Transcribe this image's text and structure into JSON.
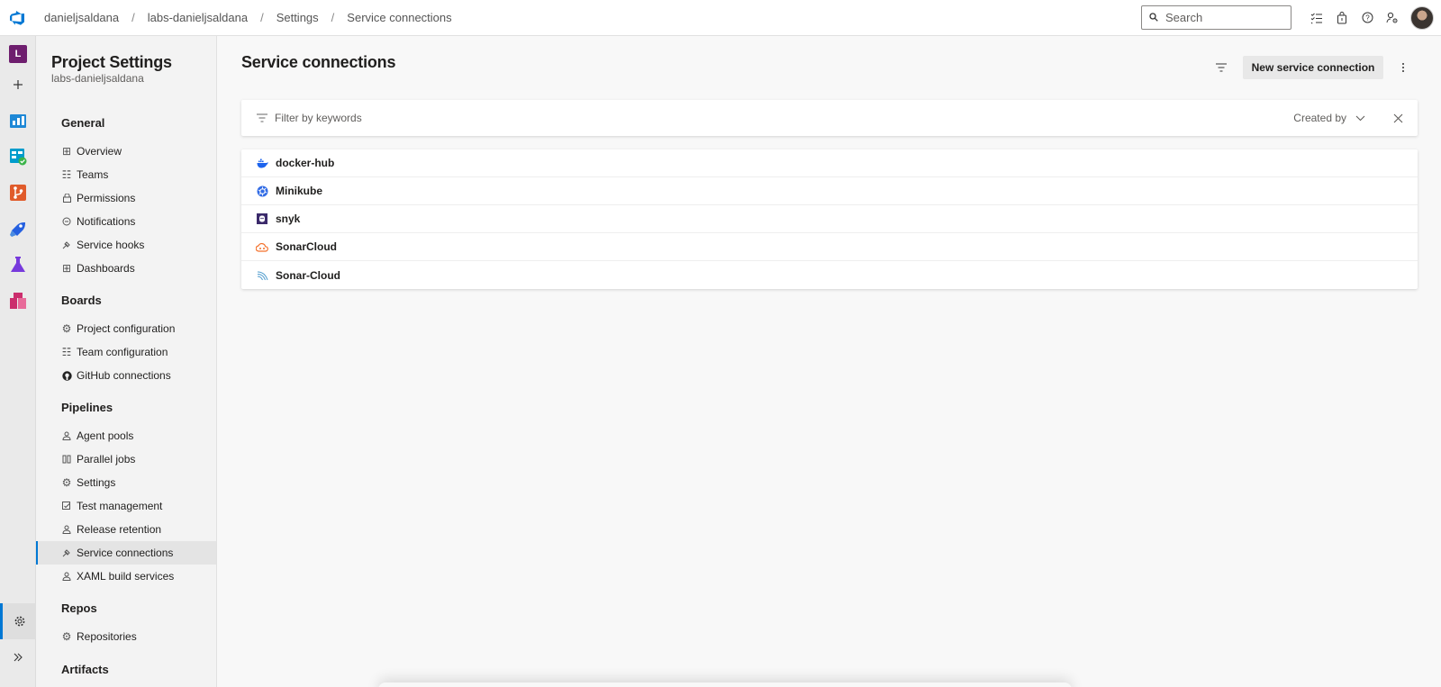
{
  "breadcrumb": [
    "danieljsaldana",
    "labs-danieljsaldana",
    "Settings",
    "Service connections"
  ],
  "search": {
    "placeholder": "Search"
  },
  "rail": {
    "org_initial": "L"
  },
  "sidebar": {
    "title": "Project Settings",
    "subtitle": "labs-danieljsaldana",
    "sections": {
      "general": "General",
      "boards": "Boards",
      "pipelines": "Pipelines",
      "repos": "Repos",
      "artifacts": "Artifacts"
    },
    "general_items": [
      "Overview",
      "Teams",
      "Permissions",
      "Notifications",
      "Service hooks",
      "Dashboards"
    ],
    "boards_items": [
      "Project configuration",
      "Team configuration",
      "GitHub connections"
    ],
    "pipelines_items": [
      "Agent pools",
      "Parallel jobs",
      "Settings",
      "Test management",
      "Release retention",
      "Service connections",
      "XAML build services"
    ],
    "repos_items": [
      "Repositories"
    ]
  },
  "main": {
    "title": "Service connections",
    "new_button": "New service connection",
    "filter_placeholder": "Filter by keywords",
    "created_by": "Created by"
  },
  "connections": [
    {
      "name": "docker-hub",
      "icon": "docker-icon"
    },
    {
      "name": "Minikube",
      "icon": "kubernetes-icon"
    },
    {
      "name": "snyk",
      "icon": "snyk-icon"
    },
    {
      "name": "SonarCloud",
      "icon": "sonarcloud-icon"
    },
    {
      "name": "Sonar-Cloud",
      "icon": "sonar-icon"
    }
  ],
  "colors": {
    "accent": "#0078d4",
    "org_badge": "#6e1e6e",
    "boards": "#009ccc",
    "repos": "#e05b2b",
    "artifacts": "#cb2e6d",
    "test_plans": "#773adc"
  }
}
